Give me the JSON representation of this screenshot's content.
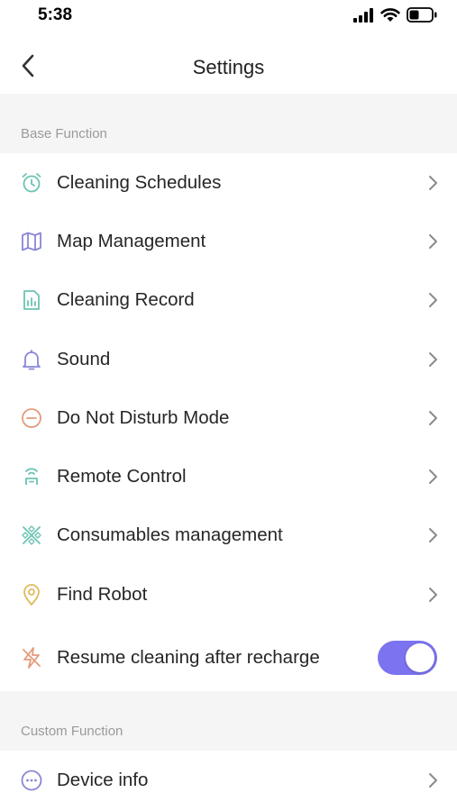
{
  "status_bar": {
    "time": "5:38"
  },
  "nav": {
    "title": "Settings"
  },
  "sections": {
    "base": {
      "label": "Base Function"
    },
    "custom": {
      "label": "Custom Function"
    }
  },
  "base_items": [
    {
      "label": "Cleaning Schedules",
      "icon": "alarm-clock-icon",
      "color": "#6cc3b4"
    },
    {
      "label": "Map Management",
      "icon": "map-icon",
      "color": "#8a86d6"
    },
    {
      "label": "Cleaning Record",
      "icon": "report-icon",
      "color": "#6cc3b4"
    },
    {
      "label": "Sound",
      "icon": "bell-icon",
      "color": "#8a86d6"
    },
    {
      "label": "Do Not Disturb Mode",
      "icon": "minus-circle-icon",
      "color": "#e49b7c"
    },
    {
      "label": "Remote Control",
      "icon": "remote-control-icon",
      "color": "#6cc3b4"
    },
    {
      "label": "Consumables management",
      "icon": "consumables-icon",
      "color": "#6cc3b4"
    },
    {
      "label": "Find Robot",
      "icon": "location-pin-icon",
      "color": "#e2b95c"
    },
    {
      "label": "Resume cleaning after recharge",
      "icon": "lightning-icon",
      "color": "#e49b7c",
      "toggle_on": true
    }
  ],
  "custom_items": [
    {
      "label": "Device info",
      "icon": "more-circle-icon",
      "color": "#8a86d6"
    }
  ],
  "accent_color": "#7b73f0"
}
